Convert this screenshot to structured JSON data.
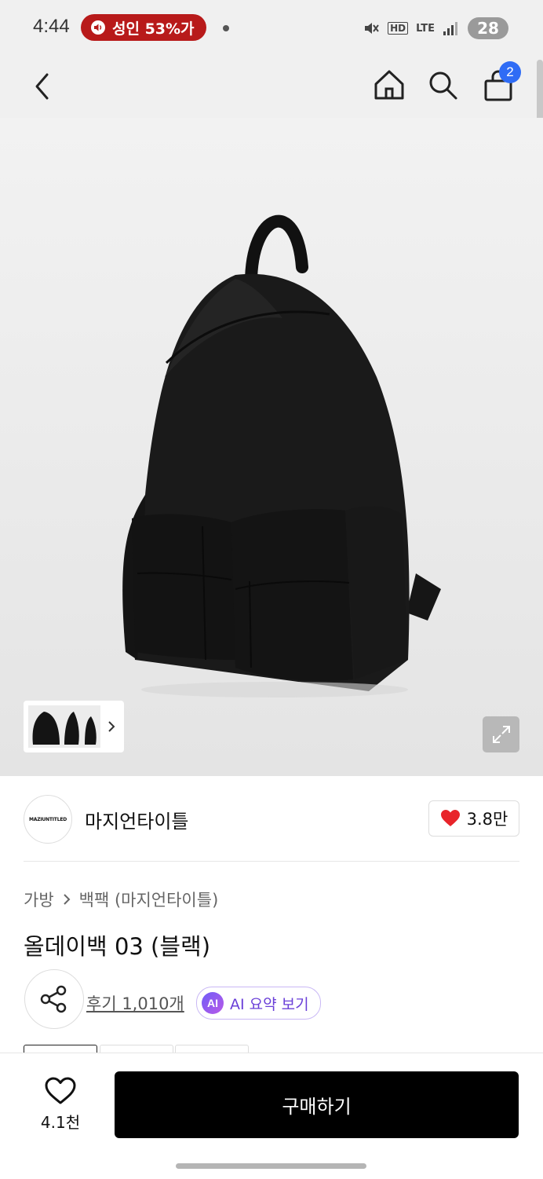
{
  "status_bar": {
    "time": "4:44",
    "recording_text": "성인 53%가",
    "network": "LTE",
    "hd_voice": "HD",
    "battery": "28"
  },
  "nav": {
    "cart_count": "2",
    "icons": [
      "back-icon",
      "home-icon",
      "search-icon",
      "cart-icon"
    ]
  },
  "brand": {
    "logo_text": "MAZIUNTITLED",
    "name": "마지언타이틀",
    "likes": "3.8만"
  },
  "breadcrumb": {
    "category": "가방",
    "subcategory": "백팩 (마지언타이틀)"
  },
  "product": {
    "title": "올데이백 03 (블랙)",
    "reviews": "후기 1,010개",
    "ai_badge": "AI",
    "ai_summary": "AI 요약 보기"
  },
  "bottom_bar": {
    "wishlist_count": "4.1천",
    "buy_label": "구매하기"
  },
  "colors": {
    "accent_blue": "#2f6cf5",
    "like_red": "#e8242a",
    "ai_purple": "#6a3fd8",
    "recording_red": "#b81a1a"
  }
}
